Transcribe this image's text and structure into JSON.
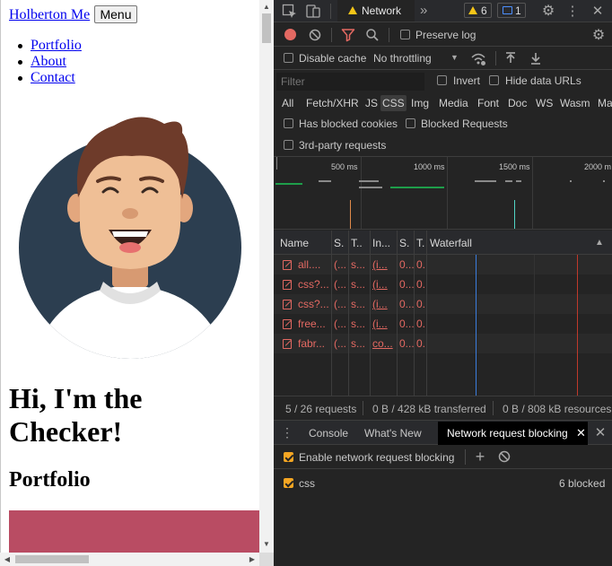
{
  "page": {
    "brand": "Holberton Me",
    "menu_button": "Menu",
    "nav": [
      "Portfolio",
      "About",
      "Contact"
    ],
    "hero_title": "Hi, I'm the Checker!",
    "portfolio_title": "Portfolio",
    "portfolio_color": "#b94c63"
  },
  "devtools": {
    "tabs": {
      "active": "Network",
      "more": "»",
      "warnings": "6",
      "messages": "1"
    },
    "toolbar": {
      "preserve_log": "Preserve log",
      "disable_cache": "Disable cache",
      "throttling": "No throttling"
    },
    "filter": {
      "placeholder": "Filter",
      "invert": "Invert",
      "hide_data_urls": "Hide data URLs"
    },
    "types": [
      "All",
      "Fetch/XHR",
      "JS",
      "CSS",
      "Img",
      "Media",
      "Font",
      "Doc",
      "WS",
      "Wasm",
      "Ma"
    ],
    "active_type": "CSS",
    "has_blocked_cookies": "Has blocked cookies",
    "blocked_requests": "Blocked Requests",
    "third_party": "3rd-party requests",
    "overview_ticks": [
      "500 ms",
      "1000 ms",
      "1500 ms",
      "2000 m"
    ],
    "columns": [
      "Name",
      "S.",
      "T..",
      "In...",
      "S.",
      "T.",
      "Waterfall"
    ],
    "requests": [
      {
        "name": "all....",
        "status": "(...",
        "type": "s...",
        "initiator": "(i...",
        "size": "0...",
        "time": "0..."
      },
      {
        "name": "css?...",
        "status": "(...",
        "type": "s...",
        "initiator": "(i...",
        "size": "0...",
        "time": "0..."
      },
      {
        "name": "css?...",
        "status": "(...",
        "type": "s...",
        "initiator": "(i...",
        "size": "0...",
        "time": "0..."
      },
      {
        "name": "free...",
        "status": "(...",
        "type": "s...",
        "initiator": "(i...",
        "size": "0...",
        "time": "0..."
      },
      {
        "name": "fabr...",
        "status": "(...",
        "type": "s...",
        "initiator": "co...",
        "size": "0...",
        "time": "0..."
      }
    ],
    "status": {
      "requests": "5 / 26 requests",
      "transferred": "0 B / 428 kB transferred",
      "resources": "0 B / 808 kB resources"
    },
    "drawer": {
      "tabs": [
        "Console",
        "What's New",
        "Network request blocking"
      ],
      "enable_blocking": "Enable network request blocking",
      "pattern": "css",
      "blocked_count": "6 blocked"
    },
    "colors": {
      "accent": "#f5a623",
      "error_red": "#e46962",
      "panel_bg": "#242424"
    }
  }
}
